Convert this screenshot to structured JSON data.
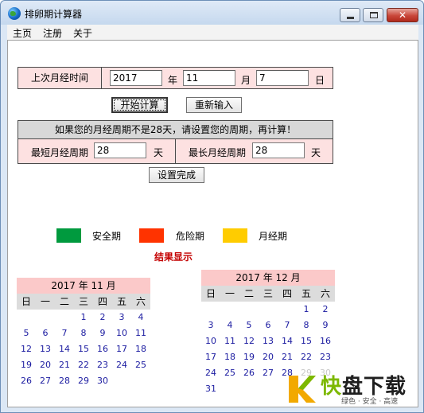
{
  "window": {
    "title": "排卵期计算器"
  },
  "menu": [
    "主页",
    "注册",
    "关于"
  ],
  "last_period": {
    "label": "上次月经时间",
    "year": "2017",
    "year_unit": "年",
    "month": "11",
    "month_unit": "月",
    "day": "7",
    "day_unit": "日"
  },
  "buttons": {
    "start": "开始计算",
    "reset": "重新输入",
    "done": "设置完成"
  },
  "cycle": {
    "note": "如果您的月经周期不是28天，请设置您的周期，再计算！",
    "shortest_label": "最短月经周期",
    "shortest_value": "28",
    "shortest_unit": "天",
    "longest_label": "最长月经周期",
    "longest_value": "28",
    "longest_unit": "天"
  },
  "legend": [
    {
      "label": "安全期",
      "color": "#009a3e"
    },
    {
      "label": "危险期",
      "color": "#ff3300"
    },
    {
      "label": "月经期",
      "color": "#ffcc00"
    }
  ],
  "result_title": "结果显示",
  "weekdays": [
    "日",
    "一",
    "二",
    "三",
    "四",
    "五",
    "六"
  ],
  "calendars": [
    {
      "title": "2017 年 11 月",
      "cells": [
        "",
        "",
        "",
        "1",
        "2",
        "3",
        "4",
        "5",
        "6",
        "7",
        "8",
        "9",
        "10",
        "11",
        "12",
        "13",
        "14",
        "15",
        "16",
        "17",
        "18",
        "19",
        "20",
        "21",
        "22",
        "23",
        "24",
        "25",
        "26",
        "27",
        "28",
        "29",
        "30",
        "",
        ""
      ]
    },
    {
      "title": "2017 年 12 月",
      "cells": [
        "",
        "",
        "",
        "",
        "",
        "1",
        "2",
        "3",
        "4",
        "5",
        "6",
        "7",
        "8",
        "9",
        "10",
        "11",
        "12",
        "13",
        "14",
        "15",
        "16",
        "17",
        "18",
        "19",
        "20",
        "21",
        "22",
        "23",
        "24",
        "25",
        "26",
        "27",
        "28",
        "29",
        "30",
        "31",
        "",
        "",
        "",
        "",
        "",
        ""
      ]
    }
  ],
  "watermark": {
    "main_a": "快",
    "main_b": "盘下载",
    "sub": "绿色 · 安全 · 高速"
  }
}
